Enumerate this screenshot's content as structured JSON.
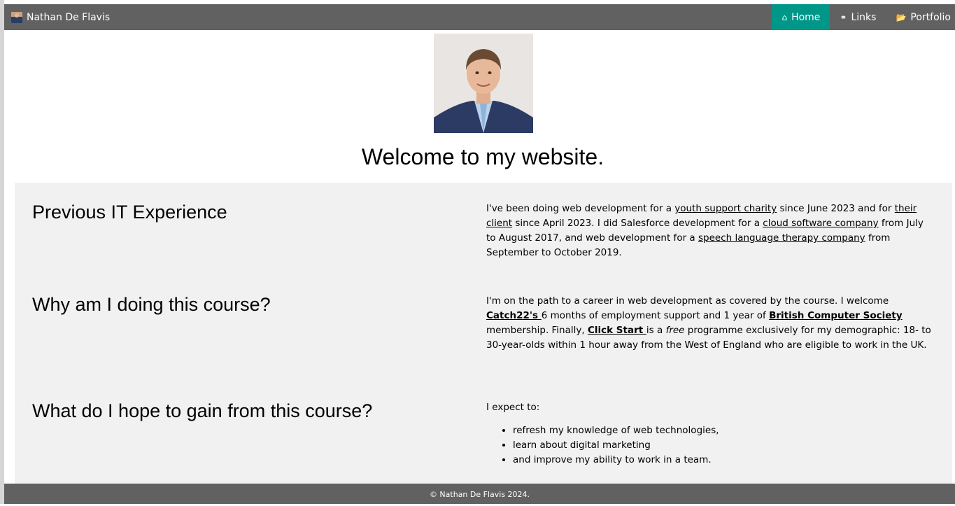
{
  "navbar": {
    "brand": "Nathan De Flavis",
    "links": [
      {
        "icon": "home-icon",
        "glyph": "⌂",
        "label": "Home"
      },
      {
        "icon": "link-icon",
        "glyph": "⚭",
        "label": "Links"
      },
      {
        "icon": "folder-open-icon",
        "glyph": "📂",
        "label": "Portfolio"
      }
    ]
  },
  "hero": {
    "heading": "Welcome to my website."
  },
  "sections": {
    "experience": {
      "title": "Previous IT Experience",
      "t1": "I've been doing web development for a ",
      "l1": "youth support charity",
      "t2": " since June 2023 and for ",
      "l2": "their client",
      "t3": " since April 2023. I did Salesforce development for a ",
      "l3": "cloud software company",
      "t4": " from July to August 2017, and web development for a ",
      "l4": "speech language therapy company",
      "t5": " from September to October 2019."
    },
    "why": {
      "title": "Why am I doing this course?",
      "t1": "I'm on the path to a career in web development as covered by the course. I welcome ",
      "l1": "Catch22's ",
      "t2": "6 months of employment support and 1 year of ",
      "l2": "British Computer Society",
      "t3": " membership. Finally, ",
      "l3": "Click Start ",
      "t4": "is a ",
      "em": "free",
      "t5": " programme exclusively for my demographic: 18- to 30-year-olds within 1 hour away from the West of England who are eligible to work in the UK."
    },
    "gain": {
      "title": "What do I hope to gain from this course?",
      "intro": "I expect to:",
      "items": [
        "refresh my knowledge of web technologies,",
        "learn about digital marketing",
        "and improve my ability to work in a team."
      ]
    }
  },
  "footer": {
    "text": "© Nathan De Flavis 2024."
  },
  "colors": {
    "navbar_bg": "#616161",
    "active_tab": "#009688",
    "content_bg": "#f1f1f1"
  }
}
